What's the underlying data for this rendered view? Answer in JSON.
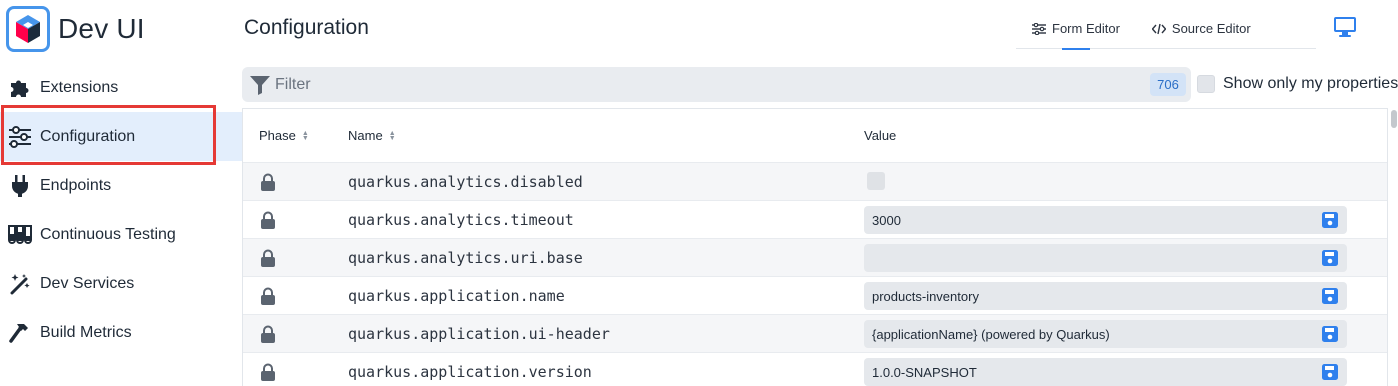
{
  "app": {
    "title": "Dev UI"
  },
  "sidebar": {
    "items": [
      {
        "label": "Extensions",
        "icon": "puzzle-icon"
      },
      {
        "label": "Configuration",
        "icon": "sliders-icon",
        "active": true
      },
      {
        "label": "Endpoints",
        "icon": "plug-icon"
      },
      {
        "label": "Continuous Testing",
        "icon": "flask-icon"
      },
      {
        "label": "Dev Services",
        "icon": "magic-wand-icon"
      },
      {
        "label": "Build Metrics",
        "icon": "hammer-icon"
      }
    ]
  },
  "header": {
    "title": "Configuration",
    "tabs": [
      {
        "label": "Form Editor",
        "selected": true
      },
      {
        "label": "Source Editor",
        "selected": false
      }
    ]
  },
  "filter": {
    "placeholder": "Filter",
    "count": "706"
  },
  "show_only_mine": {
    "label": "Show only my properties",
    "checked": false
  },
  "table": {
    "columns": [
      "Phase",
      "Name",
      "Value"
    ],
    "rows": [
      {
        "name": "quarkus.analytics.disabled",
        "type": "boolean",
        "value": ""
      },
      {
        "name": "quarkus.analytics.timeout",
        "type": "text",
        "value": "3000"
      },
      {
        "name": "quarkus.analytics.uri.base",
        "type": "text",
        "value": ""
      },
      {
        "name": "quarkus.application.name",
        "type": "text",
        "value": "products-inventory"
      },
      {
        "name": "quarkus.application.ui-header",
        "type": "text",
        "value": "{applicationName} (powered by Quarkus)"
      },
      {
        "name": "quarkus.application.version",
        "type": "text",
        "value": "1.0.0-SNAPSHOT"
      }
    ]
  },
  "colors": {
    "accent": "#2f80ed",
    "highlight": "#e53935",
    "active_bg": "#e3eefc"
  }
}
